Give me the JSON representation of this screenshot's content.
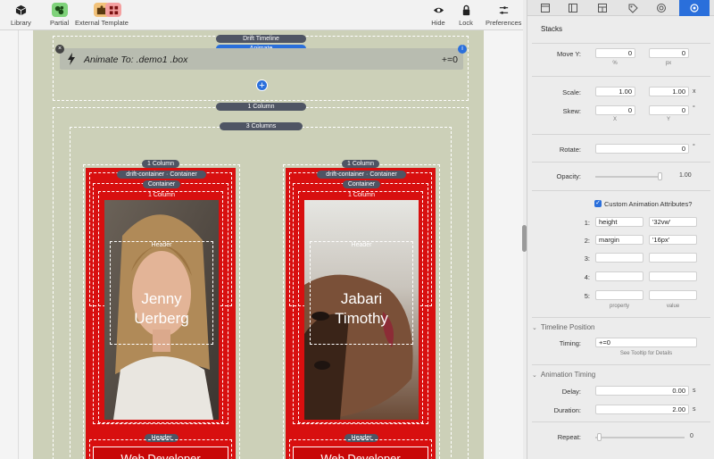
{
  "toolbar": {
    "library": "Library",
    "partial": "Partial",
    "external_template": "External Template",
    "hide": "Hide",
    "lock": "Lock",
    "preferences": "Preferences"
  },
  "canvas": {
    "drift_timeline": "Drift Timeline",
    "animate": "Animate",
    "animate_to_prefix": "Animate To:",
    "animate_to_target": " .demo1 .box",
    "animate_value": "+=0",
    "one_column": "1 Column",
    "three_columns": "3 Columns",
    "cards": [
      {
        "col_label": "1 Column",
        "drift_container": "drift-container",
        "container": "Container",
        "container_inner": "Container",
        "inner_col": "1 Column",
        "header": "Header",
        "name_line1": "Jenny",
        "name_line2": "Uerberg",
        "header_bottom": "Header",
        "role": "Web Developer"
      },
      {
        "col_label": "1 Column",
        "drift_container": "drift-container",
        "container": "Container",
        "container_inner": "Container",
        "inner_col": "1 Column",
        "header": "Header",
        "name_line1": "Jabari",
        "name_line2": "Timothy",
        "header_bottom": "Header",
        "role": "Web Developer"
      }
    ]
  },
  "inspector": {
    "title": "Stacks",
    "move_y": {
      "label": "Move Y:",
      "value1": "0",
      "value2": "0",
      "sub1": "%",
      "sub2": "px"
    },
    "scale": {
      "label": "Scale:",
      "value1": "1.00",
      "value2": "1.00",
      "unit": "x"
    },
    "skew": {
      "label": "Skew:",
      "value1": "0",
      "value2": "0",
      "unit": "°",
      "sub1": "X",
      "sub2": "Y"
    },
    "rotate": {
      "label": "Rotate:",
      "value": "0",
      "unit": "°"
    },
    "opacity": {
      "label": "Opacity:",
      "value": "1.00",
      "level": 1.0
    },
    "custom_attr": {
      "label": "Custom Animation Attributes?",
      "checked": true,
      "rows": [
        {
          "num": "1:",
          "property": "height",
          "value": "'32vw'"
        },
        {
          "num": "2:",
          "property": "margin",
          "value": "'16px'"
        },
        {
          "num": "3:",
          "property": "",
          "value": ""
        },
        {
          "num": "4:",
          "property": "",
          "value": ""
        },
        {
          "num": "5:",
          "property": "",
          "value": ""
        }
      ],
      "col_property": "property",
      "col_value": "value"
    },
    "timeline_position": {
      "header": "Timeline Position",
      "timing_label": "Timing:",
      "timing_value": "+=0",
      "tooltip_hint": "See Tooltip for Details"
    },
    "animation_timing": {
      "header": "Animation Timing",
      "delay_label": "Delay:",
      "delay_value": "0.00",
      "delay_unit": "s",
      "duration_label": "Duration:",
      "duration_value": "2.00",
      "duration_unit": "s",
      "repeat_label": "Repeat:",
      "repeat_value": "0"
    }
  },
  "colors": {
    "accent_blue": "#2a6fdb",
    "card_red": "#d80f0f",
    "page_bg": "#ccd0b8"
  }
}
